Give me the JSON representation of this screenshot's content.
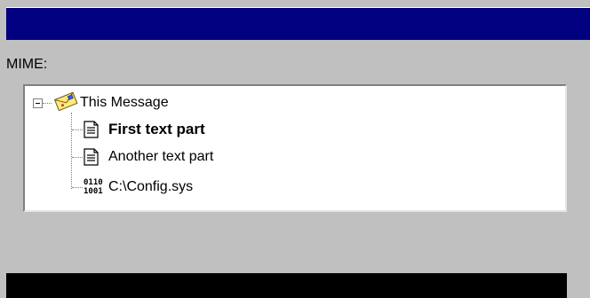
{
  "mime_section": {
    "label": "MIME:"
  },
  "tree": {
    "root": {
      "label": "This Message",
      "icon": "envelope-icon",
      "expanded": true
    },
    "children": [
      {
        "label": "First text part",
        "icon": "text-document-icon",
        "bold": true
      },
      {
        "label": "Another text part",
        "icon": "text-document-icon",
        "bold": false
      },
      {
        "label": "C:\\Config.sys",
        "icon": "binary-file-icon",
        "bold": false
      }
    ],
    "binary_icon_text": {
      "line1": "0110",
      "line2": "1001"
    }
  },
  "colors": {
    "titlebar": "#000080",
    "window_bg": "#c0c0c0",
    "tree_bg": "#ffffff",
    "bottom_bar": "#000000"
  }
}
